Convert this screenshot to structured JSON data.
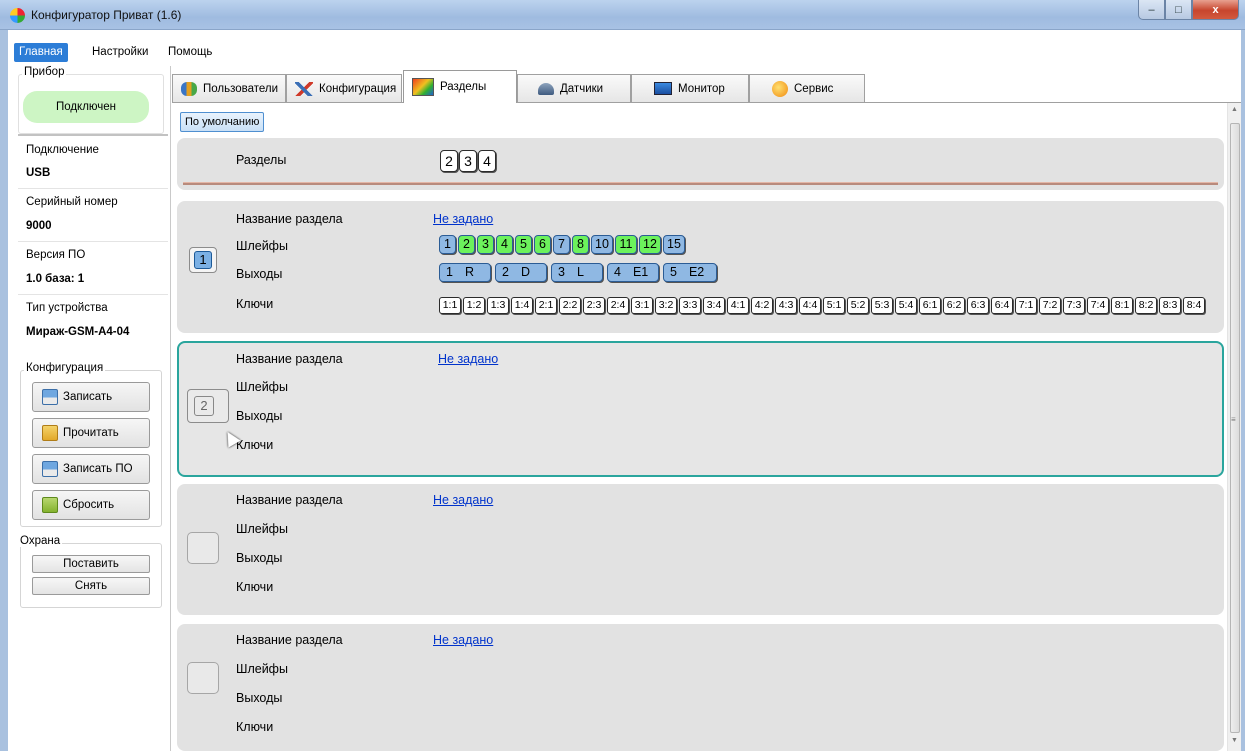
{
  "window": {
    "title": "Конфигуратор Приват (1.6)",
    "minimize": "–",
    "maximize": "□",
    "close": "x"
  },
  "menu": {
    "items": [
      "Главная",
      "Настройки",
      "Помощь"
    ]
  },
  "device": {
    "group_title": "Прибор",
    "status": "Подключен",
    "connection_label": "Подключение",
    "connection_value": "USB",
    "serial_label": "Серийный номер",
    "serial_value": "9000",
    "firmware_label": "Версия ПО",
    "firmware_value": "1.0 база: 1",
    "type_label": "Тип устройства",
    "type_value": "Мираж-GSM-A4-04"
  },
  "config": {
    "group_title": "Конфигурация",
    "write": "Записать",
    "read": "Прочитать",
    "write_fw": "Записать ПО",
    "reset": "Сбросить"
  },
  "guard": {
    "group_title": "Охрана",
    "arm": "Поставить",
    "disarm": "Снять"
  },
  "tabs": [
    "Пользователи",
    "Конфигурация",
    "Разделы",
    "Датчики",
    "Монитор",
    "Сервис"
  ],
  "toolbar": {
    "default_button": "По умолчанию"
  },
  "sections_header": {
    "label": "Разделы",
    "buttons": [
      "2",
      "3",
      "4"
    ]
  },
  "labels": {
    "name": "Название раздела",
    "loops": "Шлейфы",
    "outputs": "Выходы",
    "keys": "Ключи",
    "not_set": "Не задано"
  },
  "section1": {
    "number": "1",
    "loops": [
      {
        "t": "1",
        "c": "blue"
      },
      {
        "t": "2",
        "c": "green"
      },
      {
        "t": "3",
        "c": "green"
      },
      {
        "t": "4",
        "c": "green"
      },
      {
        "t": "5",
        "c": "green"
      },
      {
        "t": "6",
        "c": "green"
      },
      {
        "t": "7",
        "c": "blue"
      },
      {
        "t": "8",
        "c": "green"
      },
      {
        "t": "10",
        "c": "blue"
      },
      {
        "t": "11",
        "c": "green"
      },
      {
        "t": "12",
        "c": "green"
      },
      {
        "t": "15",
        "c": "blue"
      }
    ],
    "outputs": [
      {
        "n": "1",
        "v": "R"
      },
      {
        "n": "2",
        "v": "D"
      },
      {
        "n": "3",
        "v": "L"
      },
      {
        "n": "4",
        "v": "E1"
      },
      {
        "n": "5",
        "v": "E2"
      }
    ],
    "keys": [
      "1:1",
      "1:2",
      "1:3",
      "1:4",
      "2:1",
      "2:2",
      "2:3",
      "2:4",
      "3:1",
      "3:2",
      "3:3",
      "3:4",
      "4:1",
      "4:2",
      "4:3",
      "4:4",
      "5:1",
      "5:2",
      "5:3",
      "5:4",
      "6:1",
      "6:2",
      "6:3",
      "6:4",
      "7:1",
      "7:2",
      "7:3",
      "7:4",
      "8:1",
      "8:2",
      "8:3",
      "8:4"
    ]
  },
  "section2": {
    "number": "2"
  }
}
